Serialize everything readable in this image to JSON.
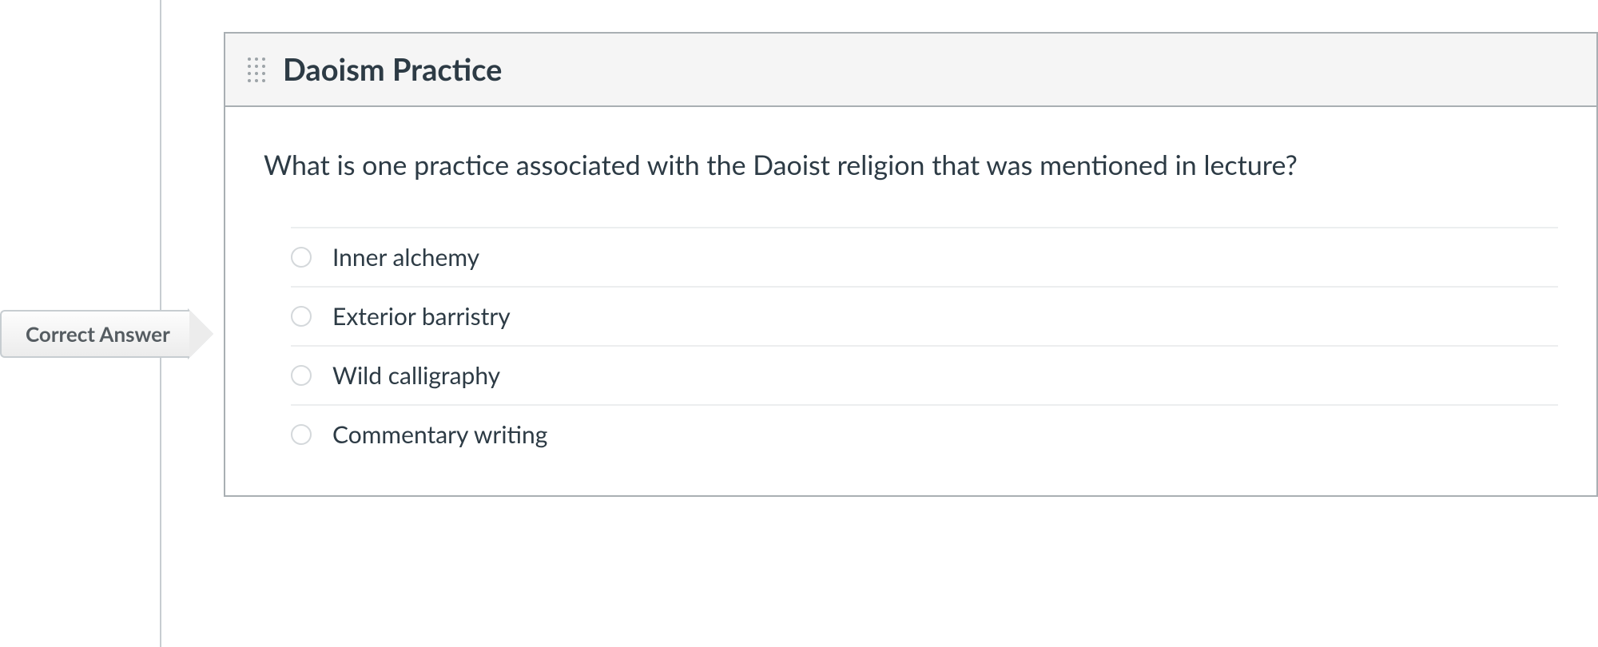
{
  "correct_answer_label": "Correct Answer",
  "question": {
    "title": "Daoism Practice",
    "prompt": "What is one practice associated with the Daoist religion that was mentioned in lecture?",
    "options": [
      {
        "label": "Inner alchemy",
        "correct": true
      },
      {
        "label": "Exterior barristry",
        "correct": false
      },
      {
        "label": "Wild calligraphy",
        "correct": false
      },
      {
        "label": "Commentary writing",
        "correct": false
      }
    ]
  }
}
